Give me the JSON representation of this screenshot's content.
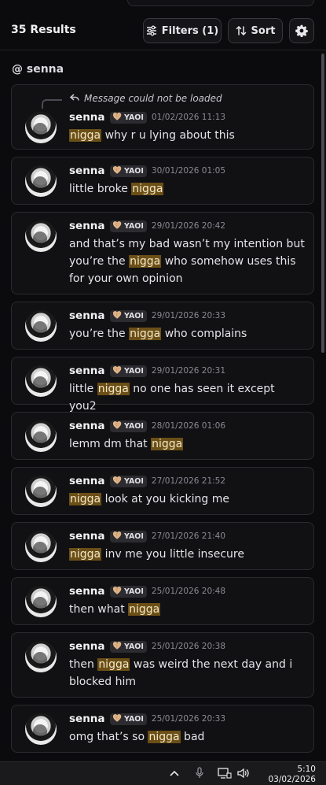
{
  "header": {
    "results": "35 Results",
    "filters_label": "Filters (1)",
    "sort_label": "Sort"
  },
  "section": {
    "label": "@ senna"
  },
  "reply_notice": "Message could not be loaded",
  "messages": [
    {
      "author": "senna",
      "tag": "YAOI",
      "time": "01/02/2026 11:13",
      "pre": "",
      "hl": "nigga",
      "post": " why r u lying about this"
    },
    {
      "author": "senna",
      "tag": "YAOI",
      "time": "30/01/2026 01:05",
      "pre": "little broke ",
      "hl": "nigga",
      "post": ""
    },
    {
      "author": "senna",
      "tag": "YAOI",
      "time": "29/01/2026 20:42",
      "pre": "and that’s my bad wasn’t my intention but you’re the ",
      "hl": "nigga",
      "post": " who somehow uses this for your own opinion"
    },
    {
      "author": "senna",
      "tag": "YAOI",
      "time": "29/01/2026 20:33",
      "pre": "you’re the ",
      "hl": "nigga",
      "post": " who complains"
    },
    {
      "author": "senna",
      "tag": "YAOI",
      "time": "29/01/2026 20:31",
      "pre": "little ",
      "hl": "nigga",
      "post": " no one has seen it except you2"
    },
    {
      "author": "senna",
      "tag": "YAOI",
      "time": "28/01/2026 01:06",
      "pre": "lemm dm that ",
      "hl": "nigga",
      "post": ""
    },
    {
      "author": "senna",
      "tag": "YAOI",
      "time": "27/01/2026 21:52",
      "pre": "",
      "hl": "nigga",
      "post": " look at you kicking me"
    },
    {
      "author": "senna",
      "tag": "YAOI",
      "time": "27/01/2026 21:40",
      "pre": "",
      "hl": "nigga",
      "post": " inv me you little insecure"
    },
    {
      "author": "senna",
      "tag": "YAOI",
      "time": "25/01/2026 20:48",
      "pre": "then what ",
      "hl": "nigga",
      "post": ""
    },
    {
      "author": "senna",
      "tag": "YAOI",
      "time": "25/01/2026 20:38",
      "pre": "then ",
      "hl": "nigga",
      "post": " was weird the next day and i blocked him"
    },
    {
      "author": "senna",
      "tag": "YAOI",
      "time": "25/01/2026 20:33",
      "pre": "omg that’s so ",
      "hl": "nigga",
      "post": " bad"
    }
  ],
  "taskbar": {
    "time": "5:10",
    "date": "03/02/2026",
    "icons": [
      "chevron-up-icon",
      "microphone-icon",
      "network-icon",
      "volume-icon"
    ]
  },
  "colors": {
    "highlight": "#6b4f16",
    "background": "#0b0b0d",
    "card": "#111114"
  }
}
